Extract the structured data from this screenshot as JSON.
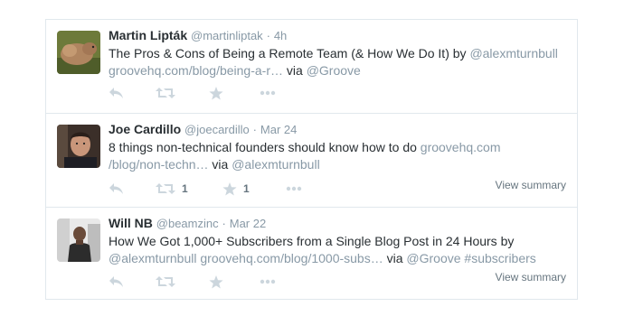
{
  "tweets": [
    {
      "name": "Martin Lipták",
      "handle": "@martinliptak",
      "time": "4h",
      "text_parts": [
        "The Pros & Cons of Being a Remote Team (& How We Do It) by ",
        "@alexmturnbull",
        " ",
        "groovehq.com/blog/being-a-r…",
        " via ",
        "@Groove"
      ],
      "icons": [
        "reply-icon",
        "retweet-icon",
        "favorite-icon",
        "more-icon"
      ]
    },
    {
      "name": "Joe Cardillo",
      "handle": "@joecardillo",
      "time": "Mar 24",
      "text_parts": [
        "8 things non-technical founders should know how to do ",
        "groovehq.com",
        "/blog/non-techn…",
        " via ",
        "@alexmturnbull"
      ],
      "retweet_count": "1",
      "favorite_count": "1",
      "summary": "View summary",
      "icons": [
        "reply-icon",
        "retweet-icon",
        "favorite-icon",
        "more-icon"
      ]
    },
    {
      "name": "Will NB",
      "handle": "@beamzinc",
      "time": "Mar 22",
      "text_parts": [
        "How We Got 1,000+ Subscribers from a Single Blog Post in 24 Hours by ",
        "@alexmturnbull",
        " ",
        "groovehq.com/blog/1000-subs…",
        " via ",
        "@Groove",
        " ",
        "#subscribers"
      ],
      "summary": "View summary",
      "icons": [
        "reply-icon",
        "retweet-icon",
        "favorite-icon",
        "more-icon"
      ]
    }
  ],
  "separator": "·",
  "colors": {
    "muted": "#8899a6",
    "text": "#292f33",
    "border": "#e1e8ed",
    "icon": "#ccd6dd"
  }
}
